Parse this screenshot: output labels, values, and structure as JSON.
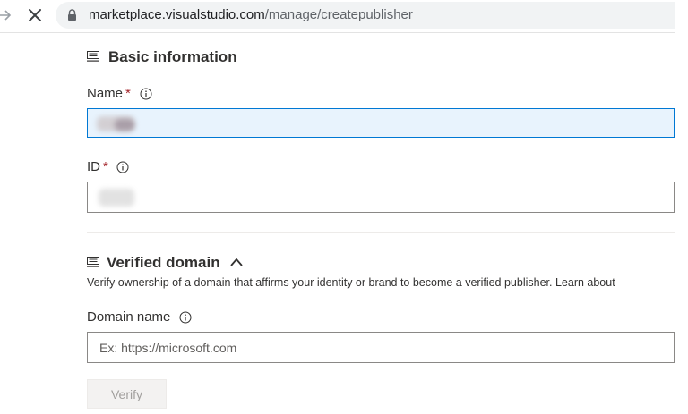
{
  "browser": {
    "url_host": "marketplace.visualstudio.com",
    "url_path": "/manage/createpublisher"
  },
  "basic_info": {
    "title": "Basic information",
    "name_label": "Name",
    "name_required": "*",
    "id_label": "ID",
    "id_required": "*"
  },
  "verified_domain": {
    "title": "Verified domain",
    "description": "Verify ownership of a domain that affirms your identity or brand to become a verified publisher. Learn about",
    "domain_label": "Domain name",
    "domain_placeholder": "Ex: https://microsoft.com",
    "verify_button": "Verify"
  },
  "colors": {
    "accent": "#0078d4",
    "required": "#a4262c",
    "focused_field_bg": "#e8f3fd"
  }
}
